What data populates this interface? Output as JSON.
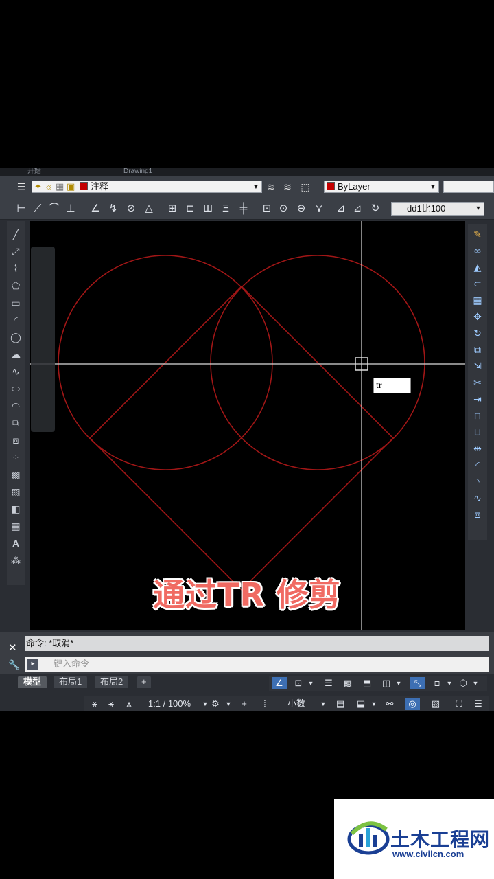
{
  "top_tabs": [
    "开始",
    "Drawing1"
  ],
  "properties": {
    "layer_name": "注释",
    "color_value": "ByLayer",
    "dim_style": "dd1比100"
  },
  "command": {
    "history": "命令: *取消*",
    "placeholder": "键入命令"
  },
  "dynamic_input": "tr",
  "caption": "通过TR 修剪",
  "layout_tabs": [
    "模型",
    "布局1",
    "布局2"
  ],
  "status": {
    "scale": "1:1 / 100%",
    "units": "小数"
  },
  "watermark": {
    "name": "土木工程网",
    "url": "www.civilcn.com"
  },
  "colors": {
    "geometry": "#a01616",
    "crosshair": "#dcdcdc",
    "canvas": "#000000"
  }
}
